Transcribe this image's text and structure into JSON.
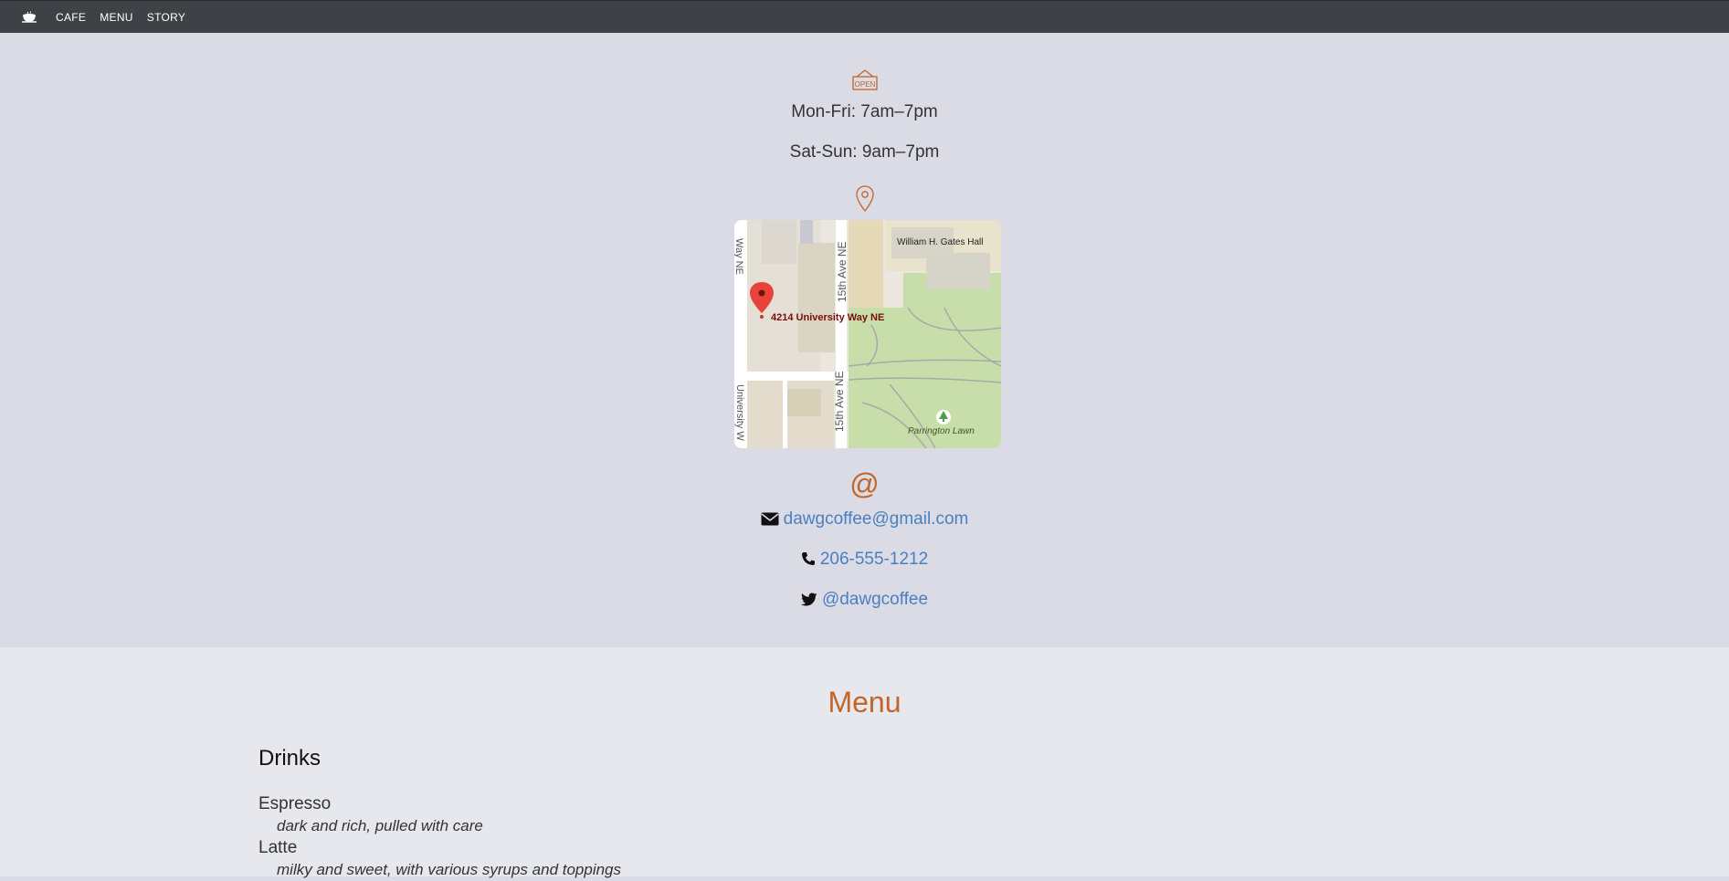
{
  "nav": {
    "brand_icon": "coffee-cup-icon",
    "links": [
      {
        "label": "CAFE"
      },
      {
        "label": "MENU"
      },
      {
        "label": "STORY"
      }
    ]
  },
  "cafe": {
    "hours_icon": "open-sign-icon",
    "hours_icon_text": "OPEN",
    "hours": [
      "Mon-Fri: 7am–7pm",
      "Sat-Sun: 9am–7pm"
    ],
    "location_icon": "map-pin-icon",
    "map": {
      "marker_label": "4214 University Way NE",
      "street_labels": [
        "Way NE",
        "15th Ave NE",
        "15th Ave NE",
        "University W"
      ],
      "place_labels": [
        "William H. Gates Hall",
        "Parrington Lawn"
      ]
    },
    "contact_icon_text": "@",
    "contacts": [
      {
        "icon": "envelope-icon",
        "text": "dawgcoffee@gmail.com"
      },
      {
        "icon": "phone-icon",
        "text": "206-555-1212"
      },
      {
        "icon": "twitter-icon",
        "text": "@dawgcoffee"
      }
    ]
  },
  "menu": {
    "title": "Menu",
    "sections": [
      {
        "heading": "Drinks",
        "items": [
          {
            "name": "Espresso",
            "description": "dark and rich, pulled with care"
          },
          {
            "name": "Latte",
            "description": "milky and sweet, with various syrups and toppings"
          }
        ]
      }
    ]
  },
  "colors": {
    "accent": "#c2652a",
    "link": "#4a7fc1",
    "nav_bg": "#3e4146",
    "cafe_bg": "#dadbe4",
    "menu_bg": "#e7e8ed"
  }
}
